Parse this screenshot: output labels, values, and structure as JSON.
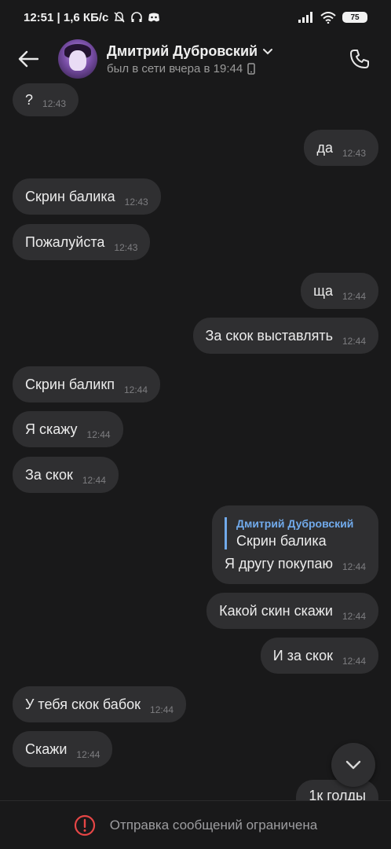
{
  "status_bar": {
    "time_and_speed": "12:51 | 1,6 КБ/с",
    "battery": "75"
  },
  "header": {
    "contact_name": "Дмитрий Дубровский",
    "last_seen": "был в сети вчера в 19:44"
  },
  "messages": [
    {
      "dir": "in",
      "text": "?",
      "time": "12:43"
    },
    {
      "dir": "out",
      "text": "да",
      "time": "12:43"
    },
    {
      "dir": "in",
      "text": "Скрин балика",
      "time": "12:43"
    },
    {
      "dir": "in",
      "text": "Пожалуйста",
      "time": "12:43"
    },
    {
      "dir": "out",
      "text": "ща",
      "time": "12:44"
    },
    {
      "dir": "out",
      "text": "За скок выставлять",
      "time": "12:44"
    },
    {
      "dir": "in",
      "text": "Скрин баликп",
      "time": "12:44"
    },
    {
      "dir": "in",
      "text": "Я скажу",
      "time": "12:44"
    },
    {
      "dir": "in",
      "text": "За скок",
      "time": "12:44"
    },
    {
      "dir": "out",
      "reply_author": "Дмитрий Дубровский",
      "reply_text": "Скрин балика",
      "text": "Я другу покупаю",
      "time": "12:44"
    },
    {
      "dir": "out",
      "text": "Какой скин скажи",
      "time": "12:44"
    },
    {
      "dir": "out",
      "text": "И за скок",
      "time": "12:44"
    },
    {
      "dir": "in",
      "text": "У тебя скок бабок",
      "time": "12:44"
    },
    {
      "dir": "in",
      "text": "Скажи",
      "time": "12:44"
    },
    {
      "dir": "out",
      "text": "1к голды",
      "time": ""
    }
  ],
  "footer": {
    "restriction_text": "Отправка сообщений ограничена"
  },
  "colors": {
    "background": "#19191a",
    "bubble": "#2f2f31",
    "accent": "#71aaeb",
    "warning": "#e64646"
  }
}
